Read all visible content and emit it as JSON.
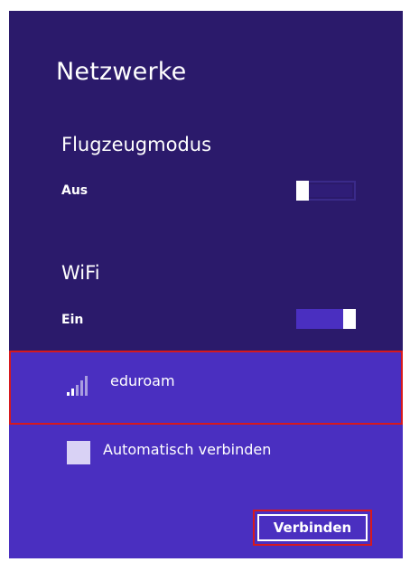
{
  "title": "Netzwerke",
  "airplane_mode": {
    "label": "Flugzeugmodus",
    "state_label": "Aus",
    "on": false
  },
  "wifi": {
    "label": "WiFi",
    "state_label": "Ein",
    "on": true
  },
  "network": {
    "name": "eduroam",
    "icon": "wifi-signal-icon",
    "signal_bars": 2,
    "signal_bars_total": 5
  },
  "auto_connect": {
    "label": "Automatisch verbinden",
    "checked": false
  },
  "connect_button": {
    "label": "Verbinden"
  },
  "colors": {
    "panel_bg": "#2b1a6b",
    "accent": "#4a2fc0",
    "highlight": "#d6191e"
  }
}
